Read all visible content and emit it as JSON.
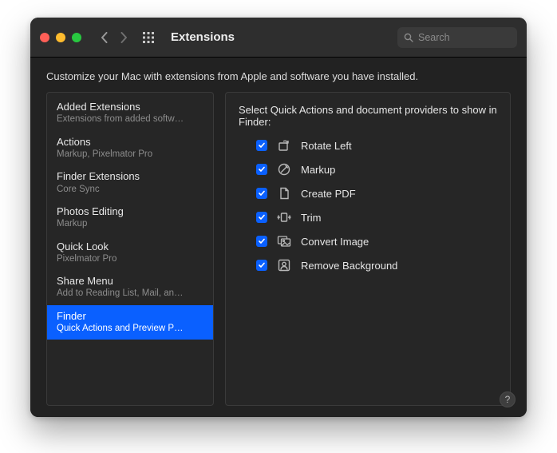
{
  "header": {
    "title": "Extensions",
    "search_placeholder": "Search"
  },
  "description": "Customize your Mac with extensions from Apple and software you have installed.",
  "sidebar": {
    "items": [
      {
        "title": "Added Extensions",
        "subtitle": "Extensions from added softw…",
        "selected": false
      },
      {
        "title": "Actions",
        "subtitle": "Markup, Pixelmator Pro",
        "selected": false
      },
      {
        "title": "Finder Extensions",
        "subtitle": "Core Sync",
        "selected": false
      },
      {
        "title": "Photos Editing",
        "subtitle": "Markup",
        "selected": false
      },
      {
        "title": "Quick Look",
        "subtitle": "Pixelmator Pro",
        "selected": false
      },
      {
        "title": "Share Menu",
        "subtitle": "Add to Reading List, Mail, an…",
        "selected": false
      },
      {
        "title": "Finder",
        "subtitle": "Quick Actions and Preview P…",
        "selected": true
      }
    ]
  },
  "detail": {
    "heading": "Select Quick Actions and document providers to show in Finder:",
    "items": [
      {
        "label": "Rotate Left",
        "icon": "rotate-left-icon",
        "checked": true
      },
      {
        "label": "Markup",
        "icon": "markup-icon",
        "checked": true
      },
      {
        "label": "Create PDF",
        "icon": "create-pdf-icon",
        "checked": true
      },
      {
        "label": "Trim",
        "icon": "trim-icon",
        "checked": true
      },
      {
        "label": "Convert Image",
        "icon": "convert-image-icon",
        "checked": true
      },
      {
        "label": "Remove Background",
        "icon": "remove-bg-icon",
        "checked": true
      }
    ]
  },
  "help_label": "?"
}
